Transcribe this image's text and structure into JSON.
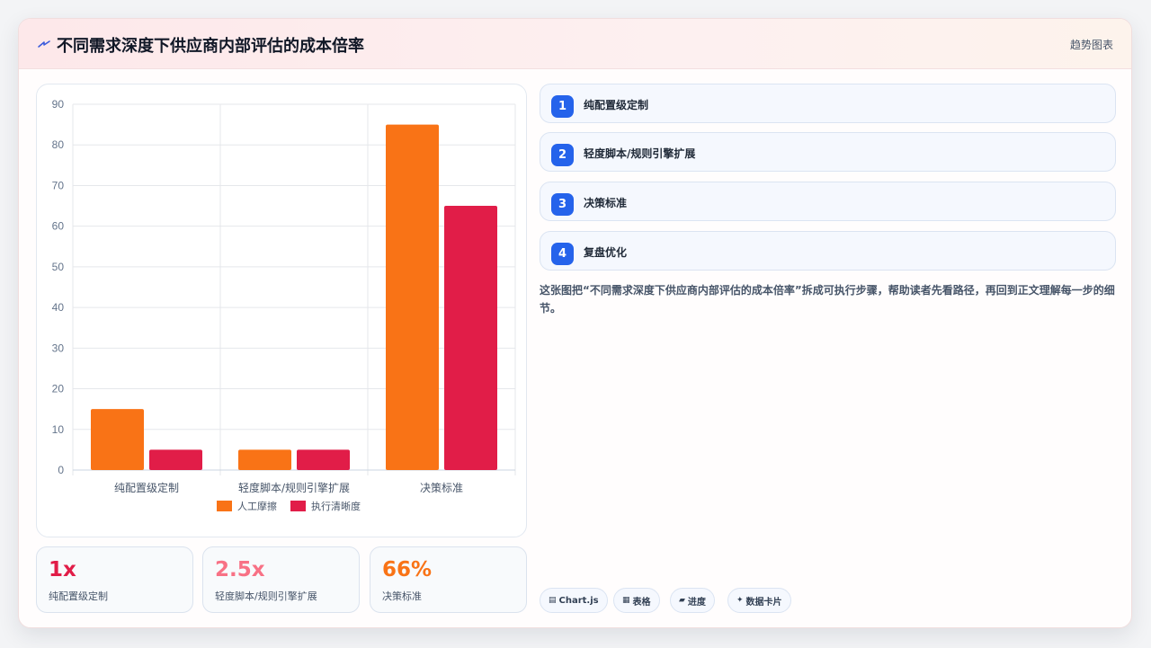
{
  "header": {
    "title": "不同需求深度下供应商内部评估的成本倍率",
    "kind": "趋势图表",
    "icon": "lightning-icon"
  },
  "chart_data": {
    "type": "bar",
    "categories": [
      "纯配置级定制",
      "轻度脚本/规则引擎扩展",
      "决策标准"
    ],
    "series": [
      {
        "name": "人工摩擦",
        "color": "#f97316",
        "values": [
          15,
          5,
          85
        ]
      },
      {
        "name": "执行清晰度",
        "color": "#e11d48",
        "values": [
          5,
          5,
          65
        ]
      }
    ],
    "ylim": [
      0,
      90
    ],
    "yticks": [
      0,
      10,
      20,
      30,
      40,
      50,
      60,
      70,
      80,
      90
    ],
    "grid": true,
    "legend": "bottom"
  },
  "stats": [
    {
      "value": "1x",
      "label": "纯配置级定制",
      "color": "#e11d48"
    },
    {
      "value": "2.5x",
      "label": "轻度脚本/规则引擎扩展",
      "color": "#f87185"
    },
    {
      "value": "66%",
      "label": "决策标准",
      "color": "#f97316"
    }
  ],
  "steps": [
    {
      "num": "1",
      "label": "纯配置级定制"
    },
    {
      "num": "2",
      "label": "轻度脚本/规则引擎扩展"
    },
    {
      "num": "3",
      "label": "决策标准"
    },
    {
      "num": "4",
      "label": "复盘优化"
    }
  ],
  "description": "这张图把“不同需求深度下供应商内部评估的成本倍率”拆成可执行步骤，帮助读者先看路径，再回到正文理解每一步的细节。",
  "tags": [
    {
      "icon": "▤",
      "label": "Chart.js"
    },
    {
      "icon": "▦",
      "label": "表格"
    },
    {
      "icon": "▰",
      "label": "进度"
    },
    {
      "icon": "✦",
      "label": "数据卡片"
    }
  ],
  "colors": {
    "accent": "#2563eb",
    "grid": "#e5e7eb",
    "axis_text": "#64748b"
  }
}
